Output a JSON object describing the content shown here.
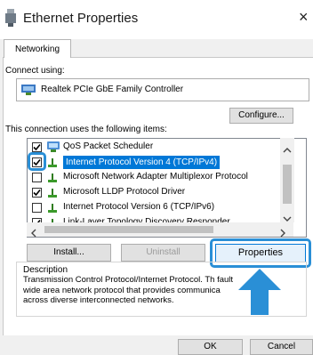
{
  "window": {
    "title": "Ethernet  Properties",
    "close_glyph": "×"
  },
  "tabs": [
    {
      "label": "Networking"
    }
  ],
  "connect_using": {
    "label": "Connect using:",
    "adapter": "Realtek PCIe GbE Family Controller"
  },
  "buttons": {
    "configure": "Configure...",
    "install": "Install...",
    "uninstall": "Uninstall",
    "properties": "Properties",
    "ok": "OK",
    "cancel": "Cancel"
  },
  "items_label": "This connection uses the following items:",
  "items": [
    {
      "label": "QoS Packet Scheduler",
      "checked": true,
      "icon": "qos-icon"
    },
    {
      "label": "Internet Protocol Version 4 (TCP/IPv4)",
      "checked": true,
      "icon": "protocol-icon",
      "selected": true
    },
    {
      "label": "Microsoft Network Adapter Multiplexor Protocol",
      "checked": false,
      "icon": "protocol-icon"
    },
    {
      "label": "Microsoft LLDP Protocol Driver",
      "checked": true,
      "icon": "protocol-icon"
    },
    {
      "label": "Internet Protocol Version 6 (TCP/IPv6)",
      "checked": false,
      "icon": "protocol-icon"
    },
    {
      "label": "Link-Layer Topology Discovery Responder",
      "checked": true,
      "icon": "protocol-icon"
    }
  ],
  "description": {
    "label": "Description",
    "lines": [
      "Transmission Control Protocol/Internet Protocol. Th   fault",
      "wide area network protocol that provides communica",
      "across diverse interconnected networks."
    ]
  },
  "colors": {
    "highlight": "#2a8fd6",
    "selection": "#0078d7"
  }
}
